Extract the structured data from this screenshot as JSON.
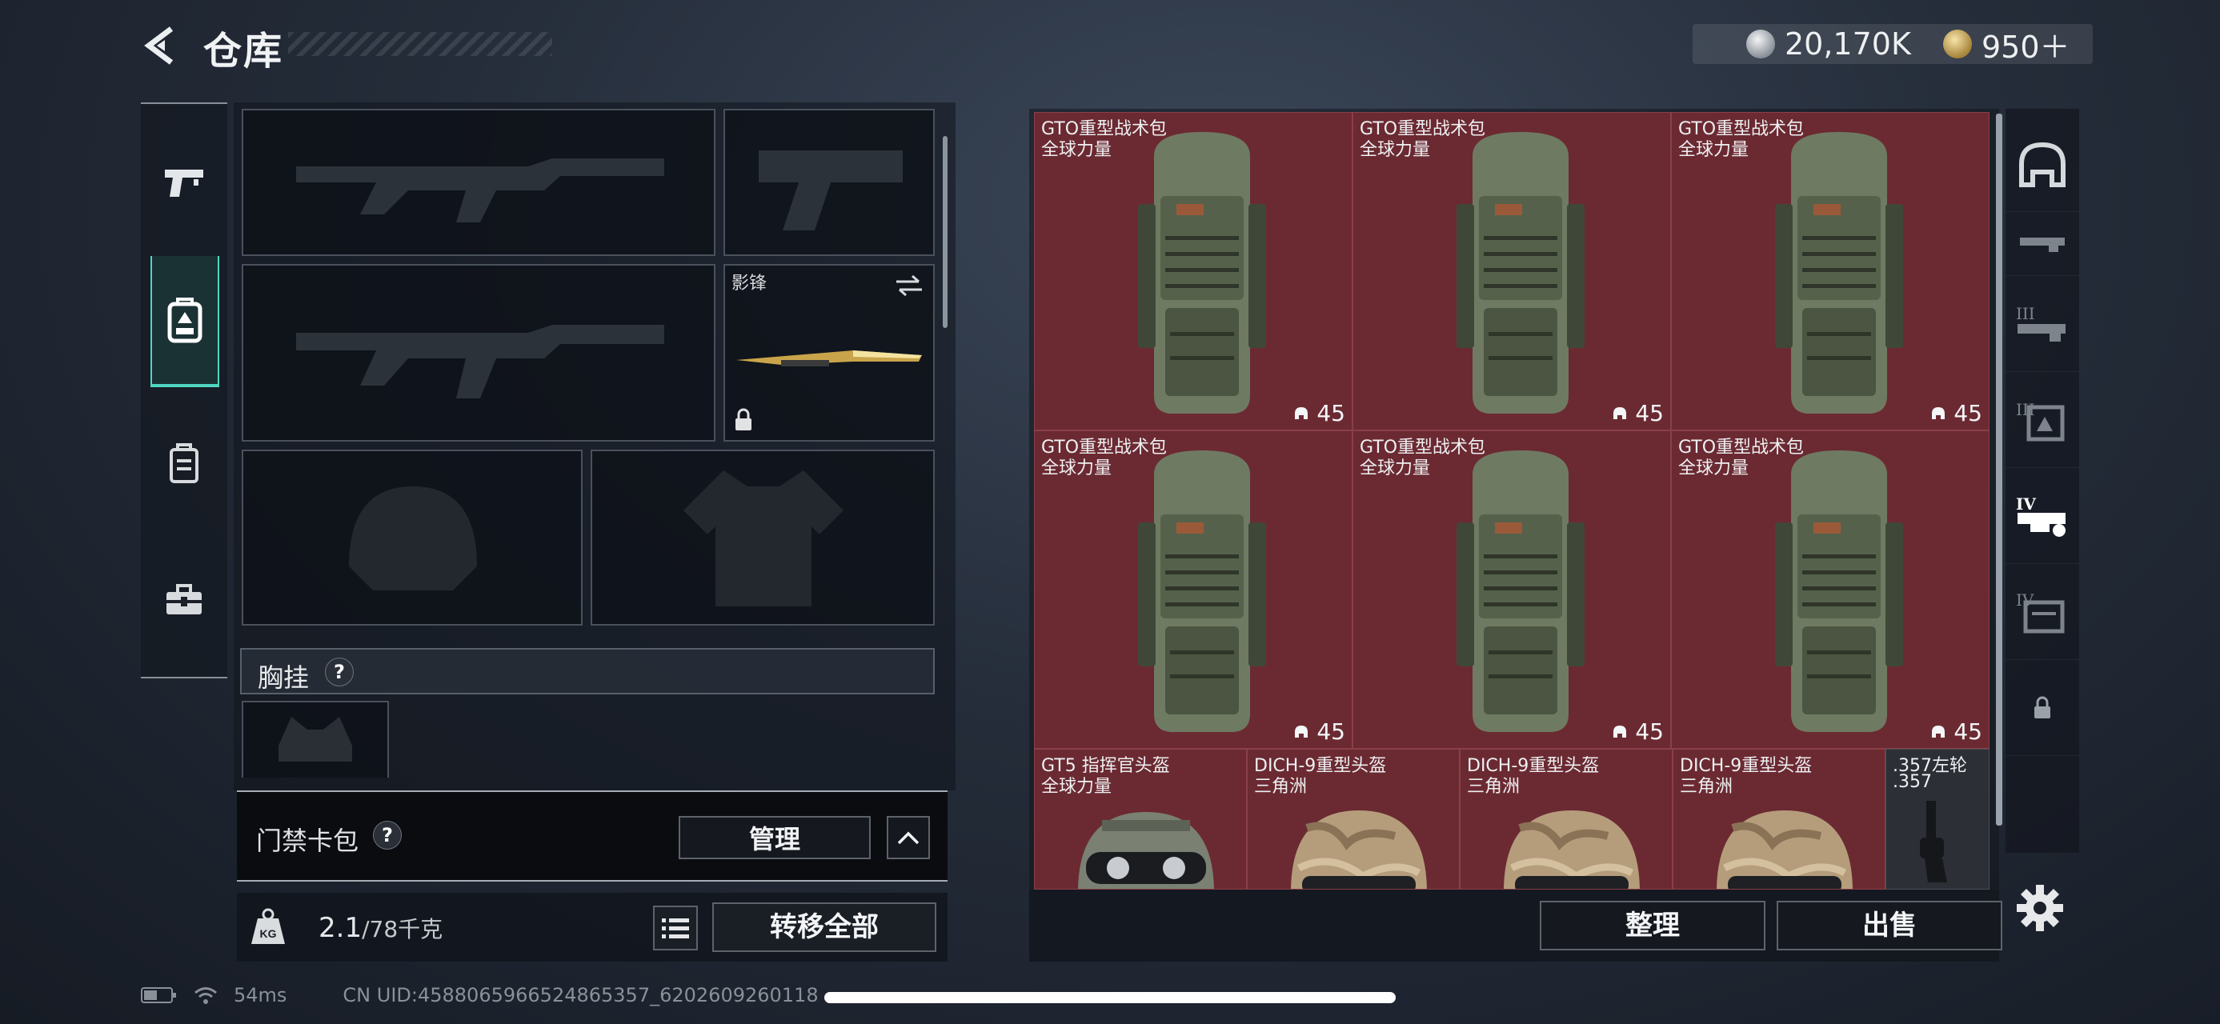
{
  "header": {
    "title": "仓库"
  },
  "currency": [
    {
      "icon": "silver-coin-icon",
      "value": "20,170K"
    },
    {
      "icon": "gold-coin-icon",
      "value": "950＋"
    }
  ],
  "left_nav": [
    {
      "icon": "pistol-icon",
      "active": false
    },
    {
      "icon": "backpack-icon",
      "active": true
    },
    {
      "icon": "chest-rig-icon",
      "active": false
    },
    {
      "icon": "toolbox-icon",
      "active": false
    }
  ],
  "loadout": {
    "secondary_weapon": {
      "name": "影锋",
      "locked": true
    },
    "chest_rig": {
      "label": "胸挂"
    },
    "access_card": {
      "label": "门禁卡包",
      "manage_label": "管理"
    },
    "weight": {
      "current": "2.1",
      "max": "/78千克"
    },
    "transfer_all_label": "转移全部"
  },
  "inventory": {
    "items": [
      {
        "name": "GTO重型战术包",
        "sub": "全球力量",
        "count": "45"
      },
      {
        "name": "GTO重型战术包",
        "sub": "全球力量",
        "count": "45"
      },
      {
        "name": "GTO重型战术包",
        "sub": "全球力量",
        "count": "45"
      },
      {
        "name": "GTO重型战术包",
        "sub": "全球力量",
        "count": "45"
      },
      {
        "name": "GTO重型战术包",
        "sub": "全球力量",
        "count": "45"
      },
      {
        "name": "GTO重型战术包",
        "sub": "全球力量",
        "count": "45"
      },
      {
        "name": "GT5 指挥官头盔",
        "sub": "全球力量"
      },
      {
        "name": "DICH-9重型头盔",
        "sub": "三角洲"
      },
      {
        "name": "DICH-9重型头盔",
        "sub": "三角洲"
      },
      {
        "name": "DICH-9重型头盔",
        "sub": "三角洲"
      },
      {
        "name": ".357左轮",
        "sub": ".357"
      }
    ],
    "sort_label": "整理",
    "sell_label": "出售"
  },
  "filters": [
    {
      "icon": "helmet-filter-icon"
    },
    {
      "icon": "armor-tier-filter-icon"
    },
    {
      "icon": "armor-tier-3-filter-icon"
    },
    {
      "icon": "armor-tier-3-plate-filter-icon"
    },
    {
      "icon": "armor-tier-4-filter-icon"
    },
    {
      "icon": "armor-tier-4-bag-filter-icon"
    },
    {
      "icon": "lock-filter-icon"
    }
  ],
  "status_bar": {
    "ping": "54ms",
    "uid": "CN UID:4588065966524865357_6202609260118"
  },
  "colors": {
    "accent": "#4fd6c0",
    "rare_red": "#6b2a32"
  }
}
